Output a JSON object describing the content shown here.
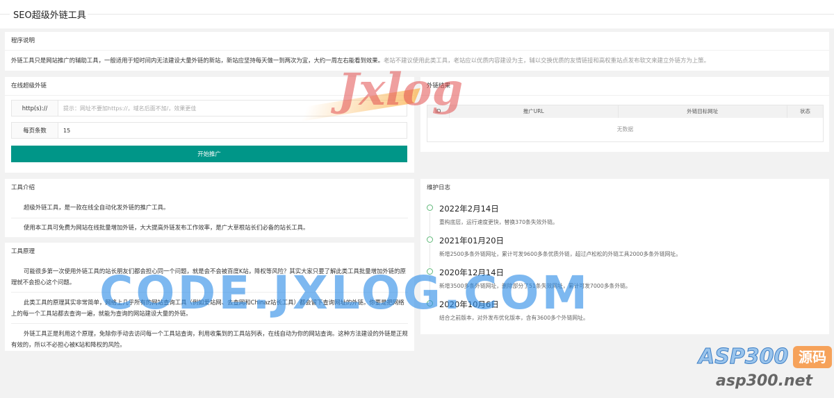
{
  "header": {
    "title": "SEO超级外链工具"
  },
  "description": {
    "title": "程序说明",
    "text_main": "外链工具只是网站推广的辅助工具，一般适用于短时间内无法建设大量外链的新站，新站应坚持每天做一到两次为宜，大约一周左右能看到效果。",
    "text_faded": "老站不建议使用此类工具，老站应以优质内容建设为主，辅以交换优质的友情链接和高权重站点发布软文来建立外链方为上策。"
  },
  "form": {
    "title": "在线超级外链",
    "url_label": "http(s)://",
    "url_placeholder": "提示：网址不要加https://，域名后面不加/，效果更佳",
    "per_page_label": "每页条数",
    "per_page_value": "15",
    "submit_label": "开始推广"
  },
  "results": {
    "title": "外链结果",
    "columns": [
      "ID",
      "推广URL",
      "外链目标网址",
      "状态"
    ],
    "empty_text": "无数据"
  },
  "intro": {
    "title": "工具介绍",
    "paragraphs": [
      "超级外链工具，是一款在线全自动化发外链的推广工具。",
      "使用本工具可免费为网站在线批量增加外链，大大提高外链发布工作效率，是广大草根站长们必备的站长工具。"
    ]
  },
  "principle": {
    "title": "工具原理",
    "paragraphs": [
      "可能很多第一次使用外链工具的站长朋友们都会担心同一个问题，就是会不会被百度K站，降权等风险？其实大家只要了解此类工具批量增加外链的原理就不会担心这个问题。",
      "此类工具的原理其实非常简单，网络上几乎所有的网站查询工具（例如爱站网、去查网和Chinaz站长工具）都会留下查询网址的外链。你要是把网络上的每一个工具站都去查询一遍，就能为查询的网站建设大量的外链。",
      "外链工具正是利用这个原理，免除你手动去访问每一个工具站查询，利用收集到的工具站列表，在线自动为你的网站查询。这种方法建设的外链是正规有效的，所以不必担心被K站和降权的风险。"
    ]
  },
  "changelog": {
    "title": "维护日志",
    "entries": [
      {
        "date": "2022年2月14日",
        "text": "重构底层，运行速度更快，替换370条失效外链。"
      },
      {
        "date": "2021年01月20日",
        "text": "新增2500多条外链网址，累计可发9600多条优质外链，超过卢松松的外链工具2000多条外链网址。"
      },
      {
        "date": "2020年12月14日",
        "text": "新增3500多条外链网址，删除部分了51条失效网址，累计可发7000多条外链。"
      },
      {
        "date": "2020年10月6日",
        "text": "结合之前版本，对外发布优化版本，含有3600多个外链网址。"
      }
    ]
  },
  "watermarks": {
    "center": "CODE.JXLOG.COM",
    "logo": "Jxlog",
    "brand": "ASP300",
    "brand_tag": "源码",
    "brand_url": "asp300.net"
  },
  "colors": {
    "accent": "#009688",
    "timeline_dot": "#5fb878"
  }
}
